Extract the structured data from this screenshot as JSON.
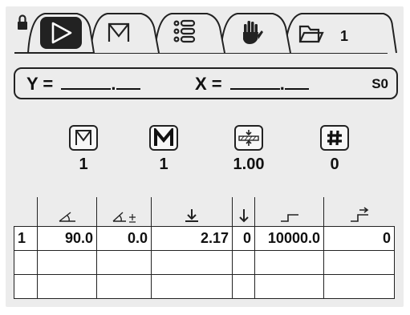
{
  "tabs": [
    {
      "name": "play",
      "active": true
    },
    {
      "name": "program-v"
    },
    {
      "name": "list"
    },
    {
      "name": "manual-hand"
    },
    {
      "name": "folder",
      "label": "1"
    }
  ],
  "lock_icon": "lock-icon",
  "coords": {
    "y_label": "Y =",
    "x_label": "X =",
    "mode": "S0"
  },
  "params": [
    {
      "icon": "die-v-icon",
      "value": "1"
    },
    {
      "icon": "m-letter-icon",
      "value": "1"
    },
    {
      "icon": "sheet-thickness-icon",
      "value": "1.00"
    },
    {
      "icon": "hash-icon",
      "value": "0"
    }
  ],
  "table": {
    "columns": [
      "index",
      "angle-icon",
      "angle-correction-icon",
      "y-axis-down-icon",
      "y-down-small-icon",
      "x-position-icon",
      "retract-icon"
    ],
    "rows": [
      [
        "1",
        "90.0",
        "0.0",
        "2.17",
        "0",
        "10000.0",
        "0"
      ],
      [
        "",
        "",
        "",
        "",
        "",
        "",
        ""
      ],
      [
        "",
        "",
        "",
        "",
        "",
        "",
        ""
      ]
    ]
  },
  "colors": {
    "screen_bg": "#ececec",
    "active_tab": "#222222",
    "line": "#222222"
  }
}
